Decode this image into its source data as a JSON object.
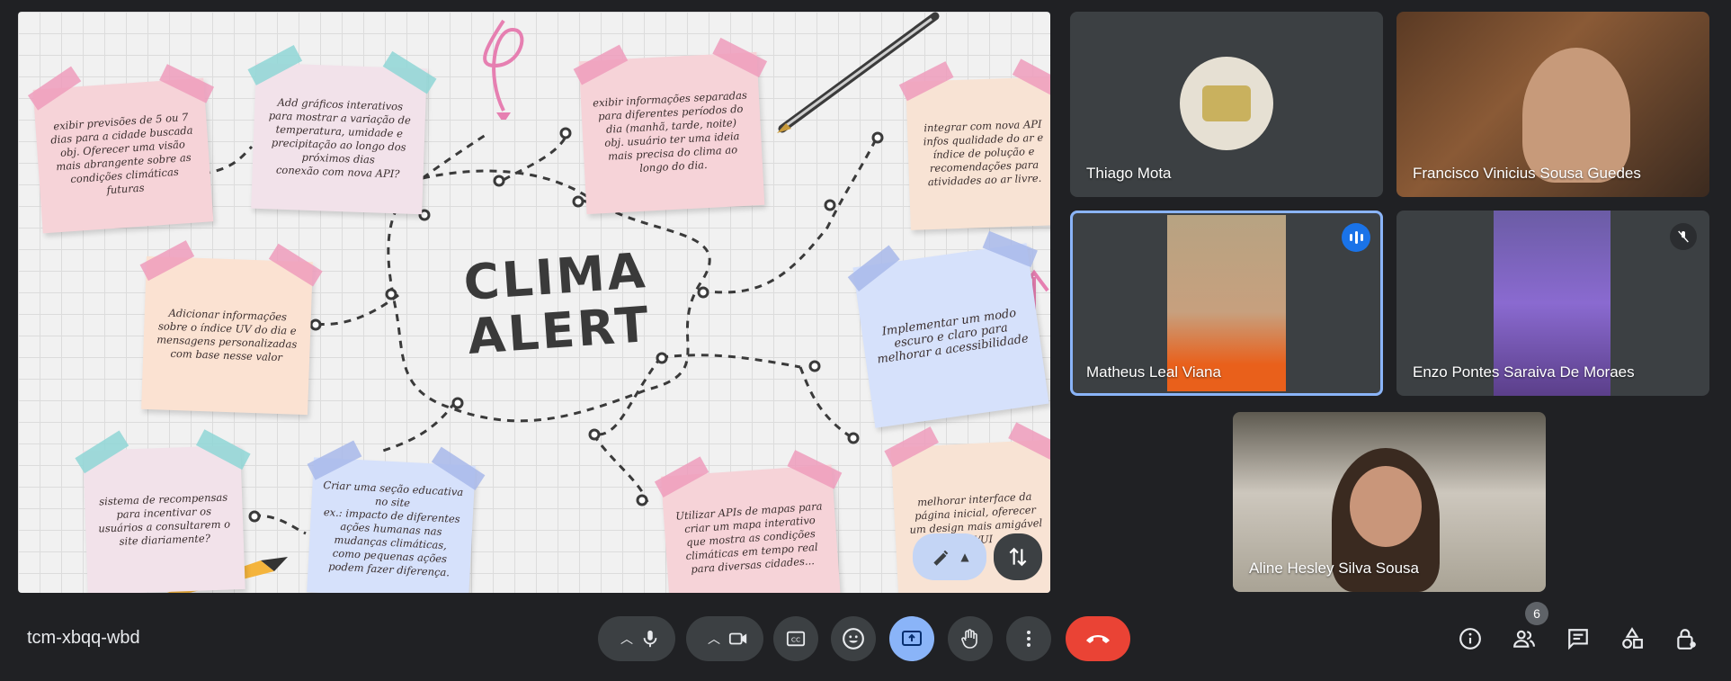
{
  "meeting": {
    "code": "tcm-xbqq-wbd"
  },
  "presentation": {
    "title": "CLIMA\nALERT",
    "notes": [
      {
        "id": "n1",
        "text": "exibir previsões de 5 ou 7 dias para a cidade buscada\nobj. Oferecer uma visão mais abrangente sobre as condições climáticas futuras"
      },
      {
        "id": "n2",
        "text": "Add gráficos interativos para mostrar a variação de temperatura, umidade e precipitação ao longo dos próximos dias\nconexão com nova API?"
      },
      {
        "id": "n3",
        "text": "exibir informações separadas para diferentes períodos do dia (manhã, tarde, noite)\nobj. usuário ter uma ideia mais precisa do clima ao longo do dia."
      },
      {
        "id": "n4",
        "text": "integrar com nova API infos qualidade do ar e índice de polução e recomendações para atividades ao ar livre."
      },
      {
        "id": "n5",
        "text": "Adicionar informações sobre o índice UV do dia e mensagens personalizadas com base nesse valor"
      },
      {
        "id": "n6",
        "text": "Implementar um modo escuro e claro para melhorar a acessibilidade"
      },
      {
        "id": "n7",
        "text": "sistema de recompensas para incentivar os usuários a consultarem o site diariamente?"
      },
      {
        "id": "n8",
        "text": "Criar uma seção educativa no site\nex.: impacto de diferentes ações humanas nas mudanças climáticas, como pequenas ações podem fazer diferença."
      },
      {
        "id": "n9",
        "text": "Utilizar APIs de mapas para criar um mapa interativo que mostra as condições climáticas em tempo real para diversas cidades..."
      },
      {
        "id": "n10",
        "text": "melhorar interface da página inicial, oferecer um design mais amigável UX/UI"
      }
    ]
  },
  "participants": [
    {
      "name": "Thiago Mota"
    },
    {
      "name": "Francisco Vinicius Sousa Guedes"
    },
    {
      "name": "Matheus Leal Viana"
    },
    {
      "name": "Enzo Pontes Saraiva De Moraes"
    },
    {
      "name": "Aline Hesley Silva Sousa"
    }
  ],
  "toolbar": {
    "participant_count": "6"
  },
  "colors": {
    "accent": "#8ab4f8",
    "end_call": "#ea4335",
    "active_speaker": "#1a73e8"
  }
}
